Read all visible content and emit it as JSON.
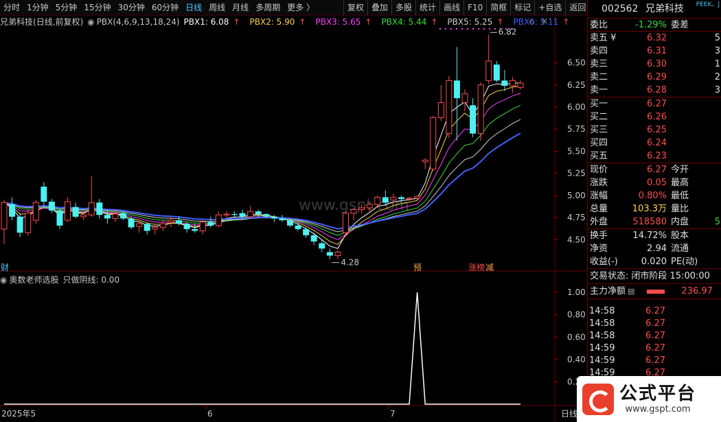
{
  "toolbar": {
    "periods": [
      "分时",
      "1分钟",
      "5分钟",
      "15分钟",
      "30分钟",
      "60分钟",
      "日线",
      "周线",
      "月线",
      "多周期",
      "更多 〉"
    ],
    "active_period": "日线",
    "tools": [
      "复权",
      "叠加",
      "多股",
      "统计",
      "画线",
      "F10",
      "简框",
      "标记",
      "+自选",
      "返回"
    ]
  },
  "main_chart": {
    "stock_name": "兄弟科技",
    "mode": "(日线,前复权)",
    "indicator_name": "PBX(4,6,9,13,18,24)",
    "pbx": [
      {
        "label": "PBX1: 6.08",
        "color": "#ffffff"
      },
      {
        "label": "PBX2: 5.90",
        "color": "#ffd24d"
      },
      {
        "label": "PBX3: 5.65",
        "color": "#ff40ff"
      },
      {
        "label": "PBX4: 5.44",
        "color": "#3cdc3c"
      },
      {
        "label": "PBX5: 5.25",
        "color": "#d0d0d0"
      },
      {
        "label": "PBX6: 5.11",
        "color": "#4060ff"
      }
    ],
    "arrow_glyph": "↑",
    "high_label": "6.82",
    "low_label": "4.28",
    "y_ticks": [
      "6.50",
      "6.25",
      "6.00",
      "5.75",
      "5.50",
      "5.25",
      "5.00",
      "4.75",
      "4.50"
    ],
    "watermark": "www.gspt.com",
    "marker_cai": "财",
    "marker_yu": "预",
    "marker_zhangbang": "涨榜",
    "marker_jian": "减"
  },
  "indicator_chart": {
    "title": "奥数老师选股",
    "value_label": "只做阴线: 0.00",
    "y_ticks": [
      "1.00",
      "0.80",
      "0.60",
      "0.40",
      "0.20"
    ]
  },
  "x_axis": {
    "labels": [
      "2025年5",
      "6",
      "7"
    ],
    "period_label": "日线"
  },
  "quote": {
    "code": "002562",
    "name": "兄弟科技",
    "peek": "PEEK、J",
    "weibi_label": "委比",
    "weibi": "-1.29%",
    "weicha_label": "委差",
    "sell": [
      {
        "label": "卖五",
        "extra": "¥",
        "price": "6.32",
        "vol": "5"
      },
      {
        "label": "卖四",
        "extra": "",
        "price": "6.31",
        "vol": "3"
      },
      {
        "label": "卖三",
        "extra": "",
        "price": "6.30",
        "vol": "1"
      },
      {
        "label": "卖二",
        "extra": "",
        "price": "6.29",
        "vol": "2"
      },
      {
        "label": "卖一",
        "extra": "",
        "price": "6.28",
        "vol": "3"
      }
    ],
    "buy": [
      {
        "label": "买一",
        "price": "6.27"
      },
      {
        "label": "买二",
        "price": "6.26"
      },
      {
        "label": "买三",
        "price": "6.25"
      },
      {
        "label": "买四",
        "price": "6.24"
      },
      {
        "label": "买五",
        "price": "6.23"
      }
    ],
    "stats": [
      {
        "l": "现价",
        "v": "6.27",
        "c": "red",
        "r": "今开"
      },
      {
        "l": "涨跌",
        "v": "0.05",
        "c": "red",
        "r": "最高"
      },
      {
        "l": "涨幅",
        "v": "0.80%",
        "c": "red",
        "r": "最低"
      },
      {
        "l": "总量",
        "v": "103.3万",
        "c": "yel",
        "r": "量比"
      },
      {
        "l": "外盘",
        "v": "518580",
        "c": "red",
        "r": "内盘",
        "extra": "5"
      }
    ],
    "stats2": [
      {
        "l": "换手",
        "v": "14.72%",
        "r": "股本"
      },
      {
        "l": "净资",
        "v": "2.94",
        "r": "流通"
      },
      {
        "l": "收益(-)",
        "v": "0.020",
        "r": "PE(动)"
      }
    ],
    "trade_status_label": "交易状态:",
    "trade_status": "闭市阶段 15:00:00",
    "main_net_label": "主力净额",
    "main_net_value": "236.97",
    "ticks": [
      {
        "t": "14:58",
        "p": "6.27"
      },
      {
        "t": "14:58",
        "p": "6.27"
      },
      {
        "t": "14:58",
        "p": "6.27"
      },
      {
        "t": "14:59",
        "p": "6.27"
      },
      {
        "t": "14:59",
        "p": "6.27"
      },
      {
        "t": "14:59",
        "p": "6.27"
      }
    ]
  },
  "logo": {
    "title": "公式平台",
    "url": "www.gspt.com"
  },
  "colors": {
    "up": "#ff4d4d",
    "down": "#4df0f0",
    "accent": "#48c8ff"
  },
  "chart_data": [
    {
      "type": "candlestick",
      "ylim": [
        4.2,
        6.9
      ],
      "ohlc": [
        [
          4.62,
          4.95,
          4.45,
          4.92
        ],
        [
          4.9,
          4.98,
          4.72,
          4.76
        ],
        [
          4.76,
          4.8,
          4.53,
          4.58
        ],
        [
          4.58,
          4.85,
          4.55,
          4.8
        ],
        [
          4.72,
          4.95,
          4.68,
          4.92
        ],
        [
          5.1,
          5.15,
          4.88,
          4.93
        ],
        [
          4.93,
          4.96,
          4.8,
          4.83
        ],
        [
          4.83,
          4.85,
          4.62,
          4.66
        ],
        [
          4.72,
          4.98,
          4.7,
          4.93
        ],
        [
          4.87,
          4.92,
          4.74,
          4.76
        ],
        [
          4.76,
          4.81,
          4.72,
          4.78
        ],
        [
          4.78,
          5.22,
          4.76,
          4.92
        ],
        [
          4.92,
          4.96,
          4.74,
          4.78
        ],
        [
          4.78,
          4.84,
          4.68,
          4.74
        ],
        [
          4.74,
          4.84,
          4.7,
          4.79
        ],
        [
          4.8,
          4.82,
          4.72,
          4.74
        ],
        [
          4.74,
          4.76,
          4.62,
          4.64
        ],
        [
          4.65,
          4.7,
          4.58,
          4.68
        ],
        [
          4.68,
          4.7,
          4.56,
          4.6
        ],
        [
          4.62,
          4.66,
          4.56,
          4.64
        ],
        [
          4.64,
          4.72,
          4.6,
          4.68
        ],
        [
          4.7,
          4.76,
          4.64,
          4.72
        ],
        [
          4.72,
          4.76,
          4.66,
          4.68
        ],
        [
          4.68,
          4.7,
          4.58,
          4.62
        ],
        [
          4.62,
          4.68,
          4.58,
          4.6
        ],
        [
          4.6,
          4.72,
          4.56,
          4.7
        ],
        [
          4.7,
          4.76,
          4.64,
          4.66
        ],
        [
          4.66,
          4.82,
          4.64,
          4.78
        ],
        [
          4.78,
          4.82,
          4.74,
          4.79
        ],
        [
          4.79,
          4.82,
          4.76,
          4.78
        ],
        [
          4.8,
          4.84,
          4.74,
          4.76
        ],
        [
          4.76,
          4.88,
          4.74,
          4.82
        ],
        [
          4.82,
          4.84,
          4.76,
          4.79
        ],
        [
          4.79,
          4.8,
          4.74,
          4.76
        ],
        [
          4.76,
          4.78,
          4.7,
          4.74
        ],
        [
          4.74,
          4.78,
          4.7,
          4.72
        ],
        [
          4.72,
          4.74,
          4.64,
          4.66
        ],
        [
          4.66,
          4.7,
          4.6,
          4.62
        ],
        [
          4.62,
          4.64,
          4.52,
          4.55
        ],
        [
          4.55,
          4.58,
          4.44,
          4.48
        ],
        [
          4.46,
          4.5,
          4.36,
          4.4
        ],
        [
          4.36,
          4.4,
          4.28,
          4.32
        ],
        [
          4.32,
          4.38,
          4.28,
          4.36
        ],
        [
          4.58,
          4.82,
          4.56,
          4.8
        ],
        [
          4.8,
          4.86,
          4.72,
          4.84
        ],
        [
          4.84,
          4.9,
          4.8,
          4.86
        ],
        [
          4.86,
          4.92,
          4.82,
          4.9
        ],
        [
          4.9,
          5.0,
          4.86,
          4.98
        ],
        [
          4.98,
          5.06,
          4.88,
          4.92
        ],
        [
          4.95,
          5.02,
          4.9,
          4.98
        ],
        [
          4.98,
          5.0,
          4.92,
          4.96
        ],
        [
          4.96,
          4.98,
          4.94,
          4.97
        ],
        [
          4.97,
          5.0,
          4.95,
          4.99
        ],
        [
          5.38,
          5.42,
          5.3,
          5.4
        ],
        [
          5.3,
          5.9,
          5.28,
          5.88
        ],
        [
          5.88,
          6.25,
          5.84,
          6.05
        ],
        [
          5.7,
          6.35,
          5.65,
          6.3
        ],
        [
          6.3,
          6.68,
          5.62,
          6.1
        ],
        [
          6.05,
          6.2,
          5.95,
          6.15
        ],
        [
          6.02,
          6.1,
          5.66,
          5.7
        ],
        [
          5.7,
          6.28,
          5.62,
          6.25
        ],
        [
          6.3,
          6.82,
          6.26,
          6.52
        ],
        [
          6.48,
          6.52,
          6.28,
          6.3
        ],
        [
          6.3,
          6.42,
          6.18,
          6.24
        ],
        [
          6.24,
          6.34,
          6.16,
          6.3
        ],
        [
          6.22,
          6.3,
          6.2,
          6.27
        ]
      ]
    },
    {
      "type": "line",
      "series": [
        {
          "name": "只做阴线",
          "values": [
            0,
            0,
            0,
            0,
            0,
            0,
            0,
            0,
            0,
            0,
            0,
            0,
            0,
            0,
            0,
            0,
            0,
            0,
            0,
            0,
            0,
            0,
            0,
            0,
            0,
            0,
            0,
            0,
            0,
            0,
            0,
            0,
            0,
            0,
            0,
            0,
            0,
            0,
            0,
            0,
            0,
            0,
            0,
            0,
            0,
            0,
            0,
            0,
            0,
            0,
            0,
            0,
            1,
            0,
            0,
            0,
            0,
            0,
            0,
            0,
            0,
            0,
            0,
            0,
            0,
            0
          ]
        }
      ],
      "ylim": [
        0,
        1.05
      ]
    }
  ]
}
